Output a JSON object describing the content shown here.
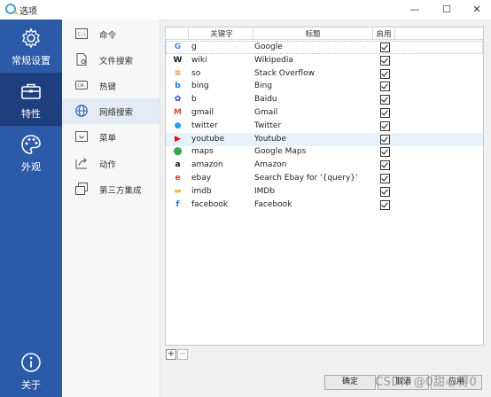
{
  "window": {
    "title": "选项",
    "minimize": "—",
    "maximize": "☐",
    "close": "✕"
  },
  "leftnav": [
    {
      "label": "常规设置",
      "icon": "gear-icon"
    },
    {
      "label": "特性",
      "icon": "toolbox-icon"
    },
    {
      "label": "外观",
      "icon": "palette-icon"
    },
    {
      "label": "关于",
      "icon": "info-icon"
    }
  ],
  "subnav": [
    {
      "label": "命令",
      "icon": "command-icon"
    },
    {
      "label": "文件搜索",
      "icon": "file-search-icon"
    },
    {
      "label": "热键",
      "icon": "hotkey-icon"
    },
    {
      "label": "网络搜索",
      "icon": "globe-icon"
    },
    {
      "label": "菜单",
      "icon": "menu-icon"
    },
    {
      "label": "动作",
      "icon": "action-icon"
    },
    {
      "label": "第三方集成",
      "icon": "integration-icon"
    }
  ],
  "table": {
    "headers": {
      "keyword": "关键字",
      "title": "标题",
      "enabled": "启用"
    },
    "rows": [
      {
        "keyword": "g",
        "title": "Google",
        "enabled": true,
        "icon": "google-icon",
        "glyph": "G",
        "color": "#4285f4"
      },
      {
        "keyword": "wiki",
        "title": "Wikipedia",
        "enabled": true,
        "icon": "wikipedia-icon",
        "glyph": "W",
        "color": "#111111"
      },
      {
        "keyword": "so",
        "title": "Stack Overflow",
        "enabled": true,
        "icon": "stackoverflow-icon",
        "glyph": "≡",
        "color": "#f48024"
      },
      {
        "keyword": "bing",
        "title": "Bing",
        "enabled": true,
        "icon": "bing-icon",
        "glyph": "b",
        "color": "#0f7ae5"
      },
      {
        "keyword": "b",
        "title": "Baidu",
        "enabled": true,
        "icon": "baidu-icon",
        "glyph": "✿",
        "color": "#2932e1"
      },
      {
        "keyword": "gmail",
        "title": "Gmail",
        "enabled": true,
        "icon": "gmail-icon",
        "glyph": "M",
        "color": "#ea4335"
      },
      {
        "keyword": "twitter",
        "title": "Twitter",
        "enabled": true,
        "icon": "twitter-icon",
        "glyph": "●",
        "color": "#1da1f2"
      },
      {
        "keyword": "youtube",
        "title": "Youtube",
        "enabled": true,
        "icon": "youtube-icon",
        "glyph": "▶",
        "color": "#ff0000"
      },
      {
        "keyword": "maps",
        "title": "Google Maps",
        "enabled": true,
        "icon": "maps-icon",
        "glyph": "⬤",
        "color": "#34a853"
      },
      {
        "keyword": "amazon",
        "title": "Amazon",
        "enabled": true,
        "icon": "amazon-icon",
        "glyph": "a",
        "color": "#111111"
      },
      {
        "keyword": "ebay",
        "title": "Search Ebay for '{query}'",
        "enabled": true,
        "icon": "ebay-icon",
        "glyph": "e",
        "color": "#e53238"
      },
      {
        "keyword": "imdb",
        "title": "IMDb",
        "enabled": true,
        "icon": "imdb-icon",
        "glyph": "▬",
        "color": "#f5c518"
      },
      {
        "keyword": "facebook",
        "title": "Facebook",
        "enabled": true,
        "icon": "facebook-icon",
        "glyph": "f",
        "color": "#1877f2"
      }
    ],
    "selected_index": 7
  },
  "toolbar": {
    "add": "+",
    "remove": "−"
  },
  "footer": {
    "ok": "确定",
    "cancel": "取消",
    "apply": "应用"
  },
  "watermark": "CSDN @0甜心得0"
}
